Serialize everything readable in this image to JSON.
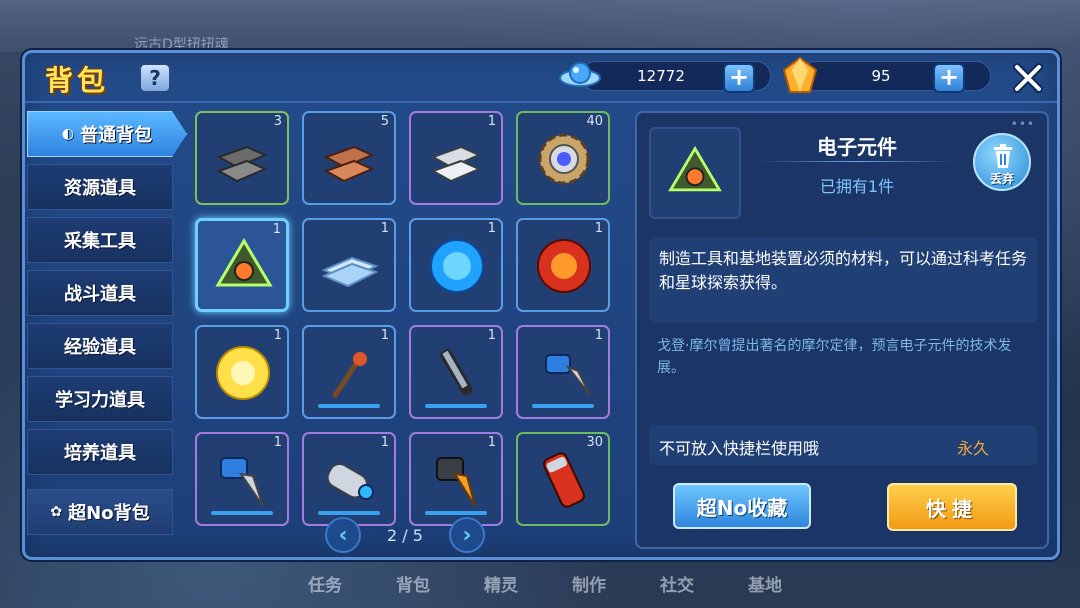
{
  "background": {
    "banner_text": "远古D型扭扭魂",
    "nav": [
      "任务",
      "背包",
      "精灵",
      "制作",
      "社交",
      "基地"
    ]
  },
  "header": {
    "title": "背包",
    "help_label": "?",
    "coins": {
      "value": "12772",
      "icon": "planet-ufo-icon"
    },
    "gems": {
      "value": "95",
      "icon": "crystal-icon"
    },
    "plus_label": "+"
  },
  "sidebar": {
    "items": [
      {
        "label": "普通背包",
        "active": true,
        "icon": "bag-icon"
      },
      {
        "label": "资源道具"
      },
      {
        "label": "采集工具"
      },
      {
        "label": "战斗道具"
      },
      {
        "label": "经验道具"
      },
      {
        "label": "学习力道具"
      },
      {
        "label": "培养道具"
      }
    ],
    "super_bag": {
      "label": "超No背包",
      "icon": "cat-icon"
    }
  },
  "inventory": {
    "items": [
      {
        "icon": "dark-metal-ingot-icon",
        "count": "3"
      },
      {
        "icon": "copper-ingot-icon",
        "count": "5"
      },
      {
        "icon": "silver-ingot-icon",
        "count": "1"
      },
      {
        "icon": "gear-core-icon",
        "count": "40"
      },
      {
        "icon": "electronic-component-icon",
        "count": "1",
        "selected": true
      },
      {
        "icon": "crystal-plate-icon",
        "count": "1"
      },
      {
        "icon": "blue-orb-icon",
        "count": "1"
      },
      {
        "icon": "red-orb-icon",
        "count": "1"
      },
      {
        "icon": "yellow-orb-icon",
        "count": "1"
      },
      {
        "icon": "hammer-tool-icon",
        "count": "1"
      },
      {
        "icon": "saw-tool-icon",
        "count": "1"
      },
      {
        "icon": "drill-tool-icon",
        "count": "1"
      },
      {
        "icon": "blue-drill-icon",
        "count": "1"
      },
      {
        "icon": "cannon-tube-icon",
        "count": "1"
      },
      {
        "icon": "orange-drill-icon",
        "count": "1"
      },
      {
        "icon": "red-battery-icon",
        "count": "30"
      }
    ],
    "page": "2 / 5",
    "prev_label": "‹",
    "next_label": "›"
  },
  "detail": {
    "name": "电子元件",
    "owned": "已拥有1件",
    "discard_label": "丢弃",
    "description": "制造工具和基地装置必须的材料，可以通过科考任务和星球探索获得。",
    "flavor": "戈登·摩尔曾提出著名的摩尔定律，预言电子元件的技术发展。",
    "note": "不可放入快捷栏使用哦",
    "duration": "永久",
    "fav_button": "超No收藏",
    "quick_button": "快捷"
  },
  "colors": {
    "panel": "#234b8a",
    "accent": "#ffe45c",
    "cyan": "#6fd0ff",
    "orange": "#f29a16"
  }
}
